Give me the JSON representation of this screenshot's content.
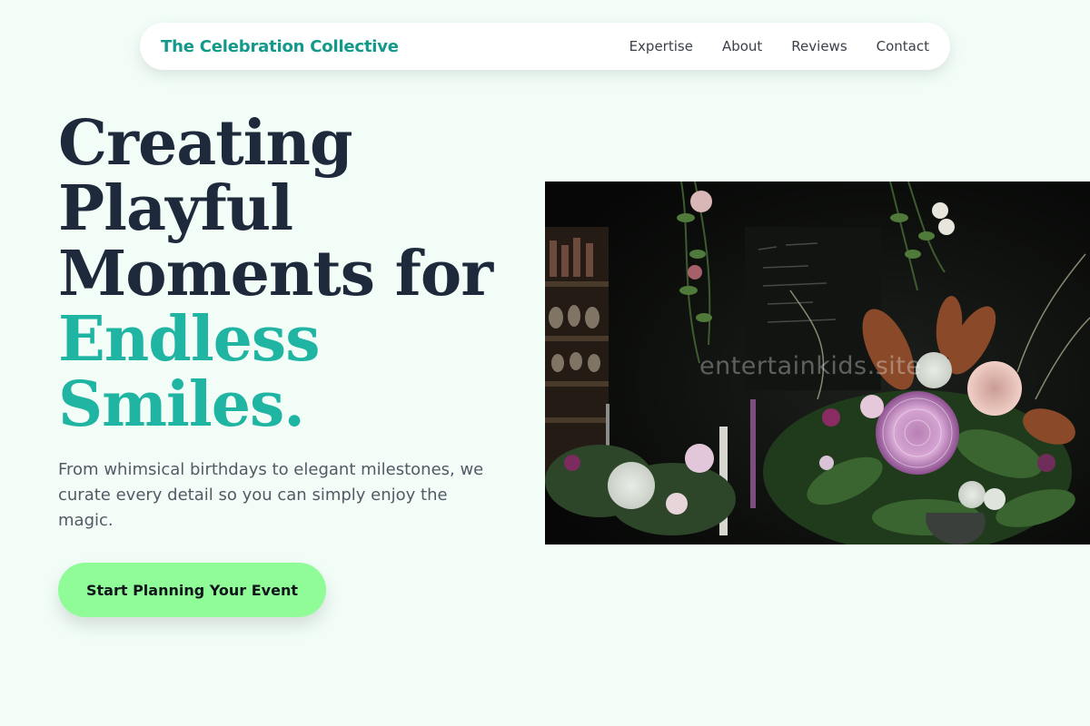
{
  "nav": {
    "brand": "The Celebration Collective",
    "links": [
      {
        "label": "Expertise"
      },
      {
        "label": "About"
      },
      {
        "label": "Reviews"
      },
      {
        "label": "Contact"
      }
    ]
  },
  "hero": {
    "headline_lines": [
      "Creating",
      "Playful",
      "Moments for"
    ],
    "headline_accent_lines": [
      "Endless",
      "Smiles."
    ],
    "subtext": "From whimsical birthdays to elegant milestones, we curate every detail so you can simply enjoy the magic.",
    "cta_label": "Start Planning Your Event",
    "image_watermark": "entertainkids.site"
  },
  "colors": {
    "background": "#f2fdf8",
    "brand": "#119a8a",
    "headline": "#1e293b",
    "accent": "#1fb5a2",
    "cta": "#8ffc98"
  }
}
